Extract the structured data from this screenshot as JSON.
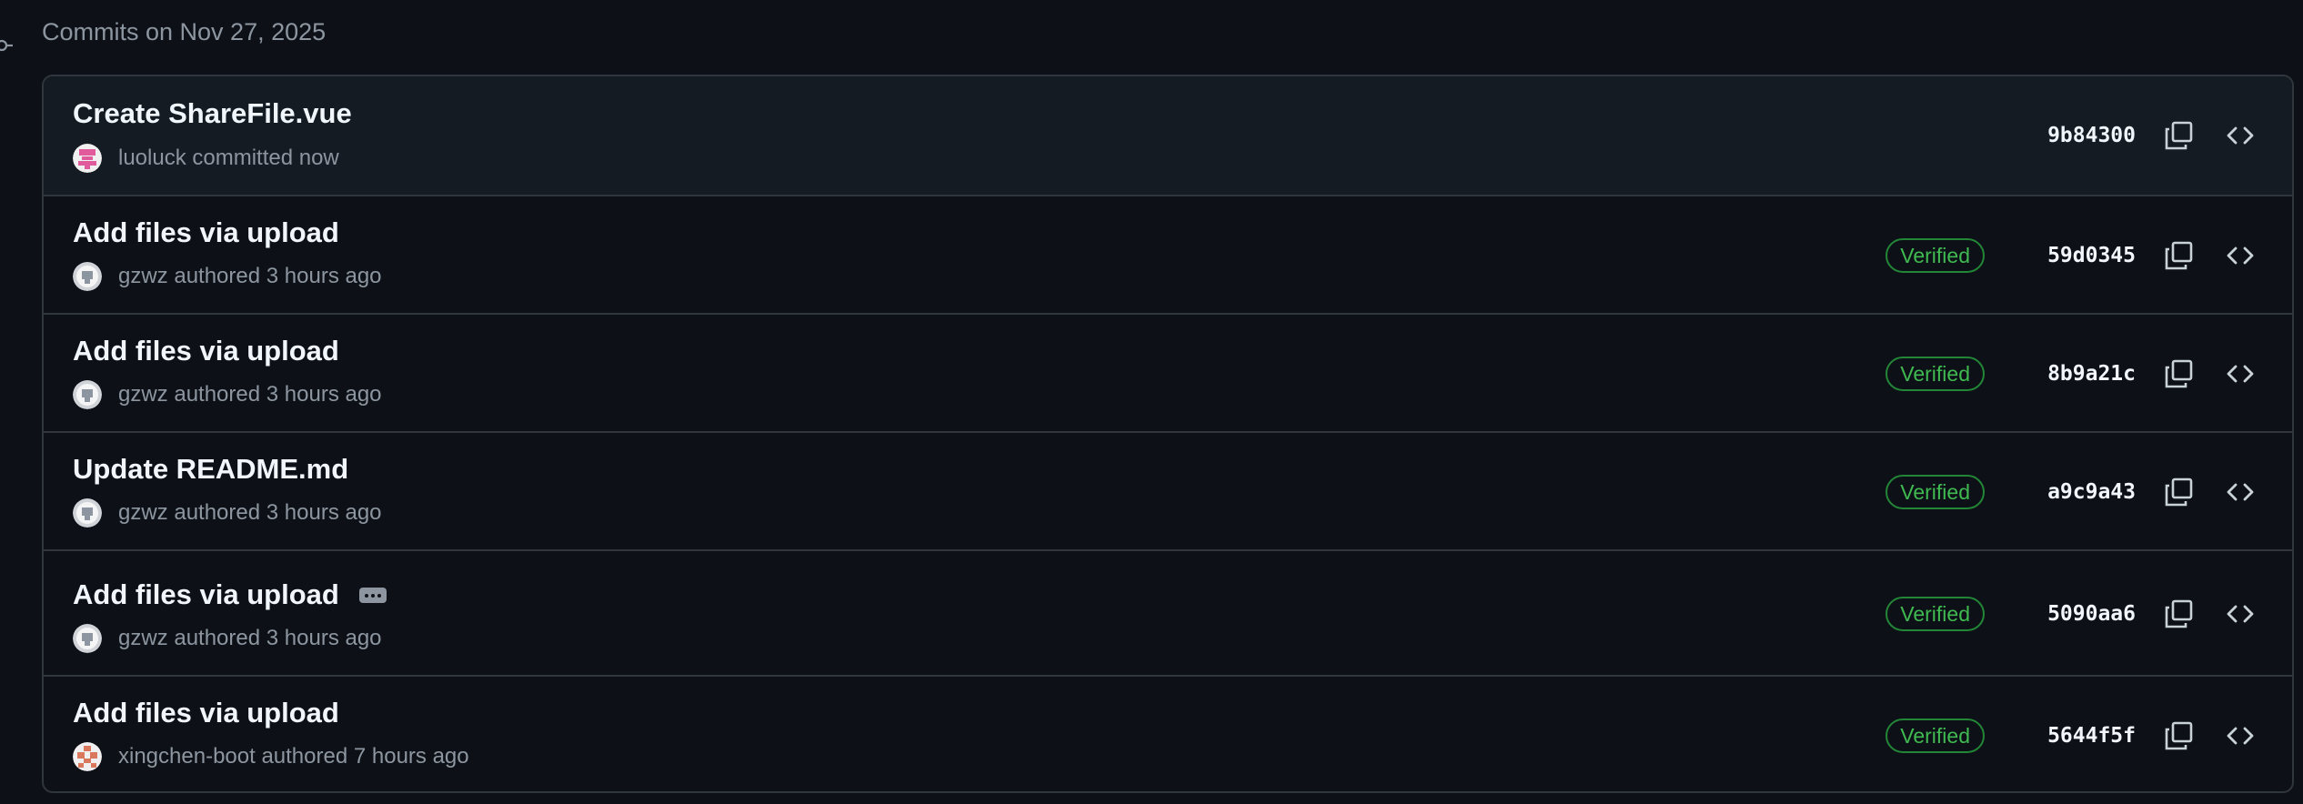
{
  "group": {
    "title": "Commits on Nov 27, 2025"
  },
  "commits": [
    {
      "title": "Create ShareFile.vue",
      "meta": "luoluck committed now",
      "verified": "",
      "sha": "9b84300",
      "has_ellipsis": false,
      "avatar": "pink-identicon"
    },
    {
      "title": "Add files via upload",
      "meta": "gzwz authored 3 hours ago",
      "verified": "Verified",
      "sha": "59d0345",
      "has_ellipsis": false,
      "avatar": "default-avatar"
    },
    {
      "title": "Add files via upload",
      "meta": "gzwz authored 3 hours ago",
      "verified": "Verified",
      "sha": "8b9a21c",
      "has_ellipsis": false,
      "avatar": "default-avatar"
    },
    {
      "title": "Update README.md",
      "meta": "gzwz authored 3 hours ago",
      "verified": "Verified",
      "sha": "a9c9a43",
      "has_ellipsis": false,
      "avatar": "default-avatar"
    },
    {
      "title": "Add files via upload",
      "meta": "gzwz authored 3 hours ago",
      "verified": "Verified",
      "sha": "5090aa6",
      "has_ellipsis": true,
      "avatar": "default-avatar"
    },
    {
      "title": "Add files via upload",
      "meta": "xingchen-boot authored 7 hours ago",
      "verified": "Verified",
      "sha": "5644f5f",
      "has_ellipsis": false,
      "avatar": "orange-identicon"
    }
  ],
  "icons": {
    "commit_node": "git-commit-icon",
    "copy": "copy-icon",
    "browse": "code-icon",
    "ellipsis": "kebab-horizontal-icon"
  },
  "colors": {
    "background": "#0d1117",
    "row_highlight": "#151b23",
    "border": "#30363d",
    "verified": "#3fb950",
    "muted_text": "#8d96a0"
  }
}
